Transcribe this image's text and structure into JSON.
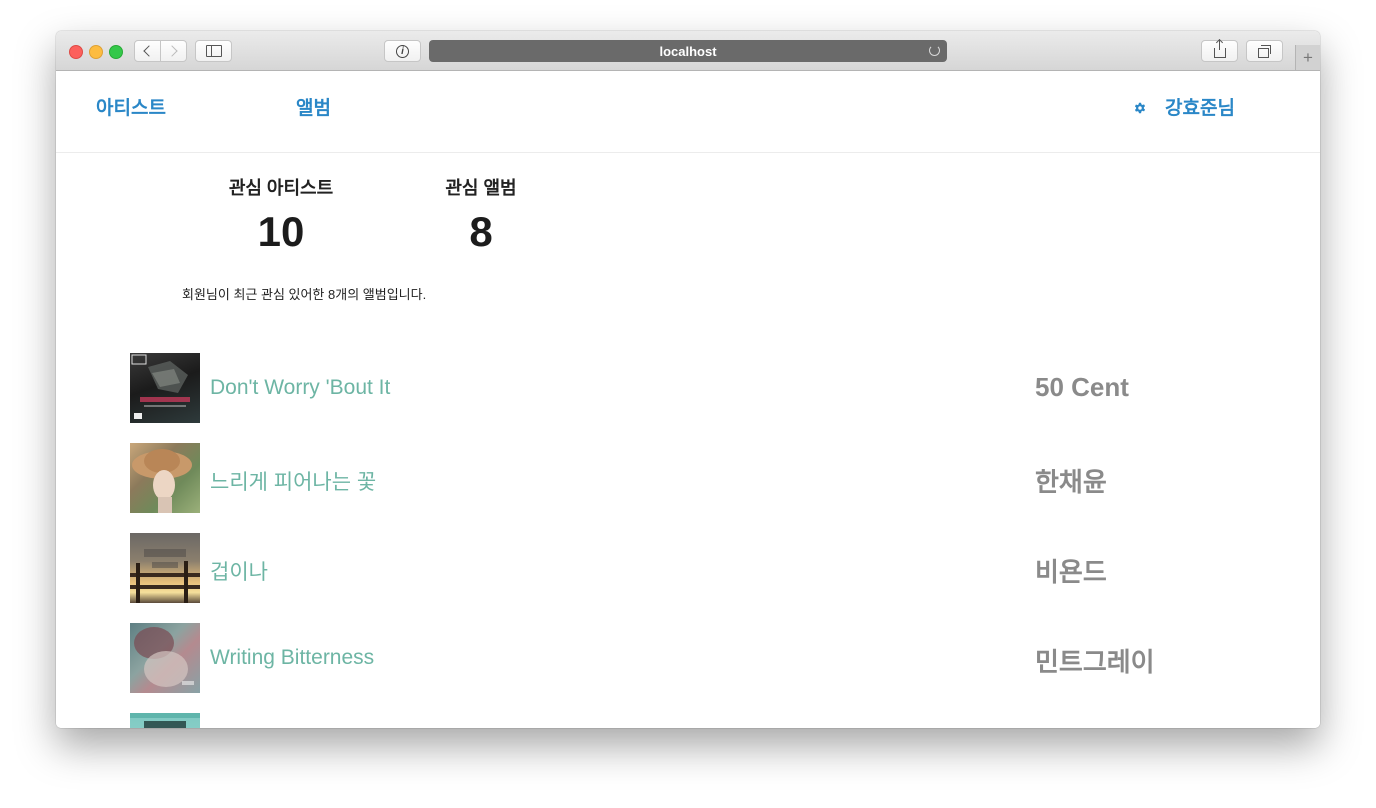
{
  "browser": {
    "url": "localhost"
  },
  "nav": {
    "artists": "아티스트",
    "albums": "앨범",
    "user": "강효준님"
  },
  "stats": {
    "artists_label": "관심 아티스트",
    "artists_count": "10",
    "albums_label": "관심 앨범",
    "albums_count": "8"
  },
  "description": "회원님이 최근 관심 있어한 8개의 앨범입니다.",
  "albums": [
    {
      "title": "Don't Worry 'Bout It",
      "artist": "50 Cent"
    },
    {
      "title": "느리게 피어나는 꽃",
      "artist": "한채윤"
    },
    {
      "title": "겁이나",
      "artist": "비욘드"
    },
    {
      "title": "Writing Bitterness",
      "artist": "민트그레이"
    },
    {
      "title": "",
      "artist": ""
    }
  ],
  "colors": {
    "nav_link": "#2a87c7",
    "album_title": "#6db5a4",
    "artist_name": "#8a8a8a"
  }
}
